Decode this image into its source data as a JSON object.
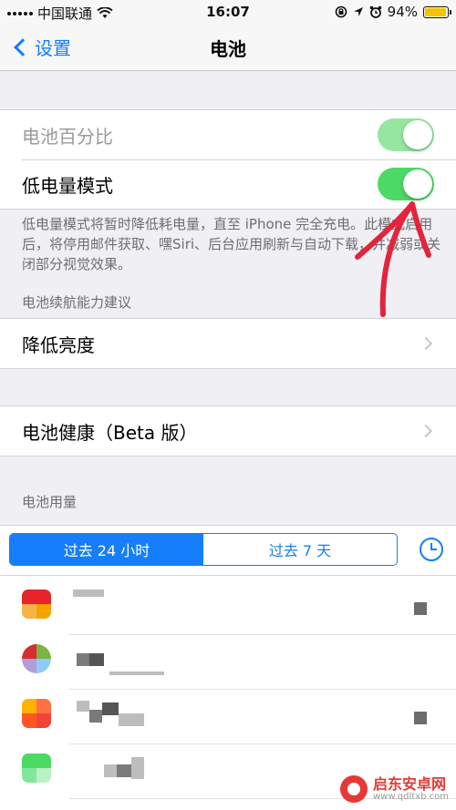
{
  "status_bar": {
    "carrier": "中国联通",
    "time": "16:07",
    "battery_percent": "94%",
    "battery_level": 0.94,
    "icons": [
      "signal-icon",
      "wifi-icon",
      "rotation-lock-icon",
      "location-icon",
      "alarm-icon",
      "battery-icon"
    ]
  },
  "nav": {
    "back_label": "设置",
    "title": "电池"
  },
  "settings": {
    "battery_percentage": {
      "label": "电池百分比",
      "on": true,
      "disabled": true
    },
    "low_power_mode": {
      "label": "低电量模式",
      "on": true
    },
    "low_power_footer": "低电量模式将暂时降低耗电量，直至 iPhone 完全充电。此模式启用后，将停用邮件获取、嘿Siri、后台应用刷新与自动下载，并减弱或关闭部分视觉效果。",
    "suggestions_header": "电池续航能力建议",
    "reduce_brightness": "降低亮度",
    "battery_health": "电池健康（Beta 版）",
    "usage_header": "电池用量"
  },
  "usage": {
    "segments": [
      "过去 24 小时",
      "过去 7 天"
    ],
    "selected_index": 0
  },
  "colors": {
    "accent": "#147efb",
    "toggle_on": "#4cd964",
    "annotation_red": "#e3243b"
  },
  "watermark": {
    "name": "启东安卓网",
    "url": "www.qdltxb.com"
  }
}
